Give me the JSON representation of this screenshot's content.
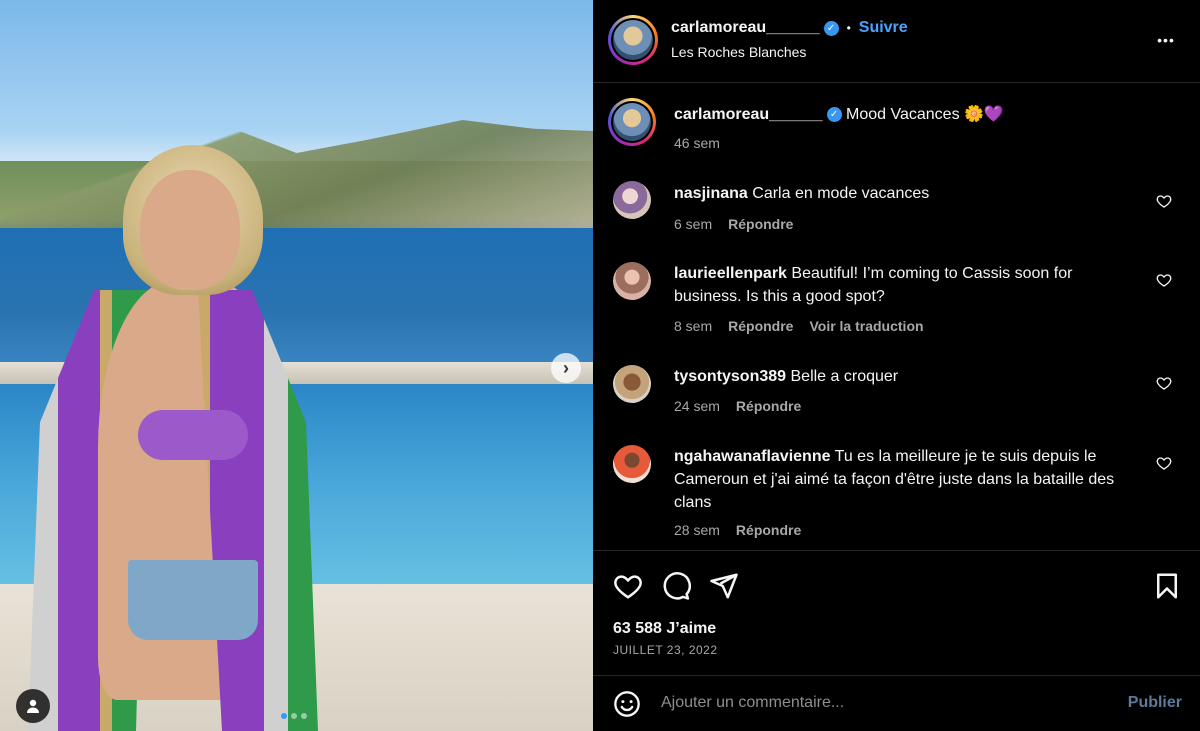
{
  "post": {
    "username": "carlamoreau______",
    "follow_label": "Suivre",
    "dot": "•",
    "location": "Les Roches Blanches",
    "more_label": "•••",
    "caption_user": "carlamoreau______",
    "caption_text": "Mood Vacances 🌼💜",
    "caption_time": "46 sem",
    "likes": "63 588 J’aime",
    "date": "JUILLET 23, 2022",
    "carousel_next": "›",
    "carousel_dots": 3,
    "carousel_active_index": 0
  },
  "comments": [
    {
      "user": "nasjinana",
      "text": "Carla en mode vacances",
      "time": "6 sem",
      "reply": "Répondre",
      "translate": ""
    },
    {
      "user": "laurieellenpark",
      "text": "Beautiful! I’m coming to Cassis soon for business. Is this a good spot?",
      "time": "8 sem",
      "reply": "Répondre",
      "translate": "Voir la traduction"
    },
    {
      "user": "tysontyson389",
      "text": "Belle a croquer",
      "time": "24 sem",
      "reply": "Répondre",
      "translate": ""
    },
    {
      "user": "ngahawanaflavienne",
      "text": "Tu es la meilleure je te suis depuis le Cameroun et j'ai aimé ta façon d'être juste dans la bataille des clans",
      "time": "28 sem",
      "reply": "Répondre",
      "translate": ""
    }
  ],
  "comment_box": {
    "placeholder": "Ajouter un commentaire...",
    "publish_label": "Publier"
  },
  "colors": {
    "background": "#000000",
    "accent_link": "#4aa3ff",
    "muted_text": "#a8a8a8",
    "divider": "#262626"
  },
  "icons": [
    "heart-icon",
    "comment-icon",
    "share-icon",
    "bookmark-icon",
    "emoji-icon",
    "more-icon",
    "user-tag-icon",
    "verified-icon"
  ]
}
